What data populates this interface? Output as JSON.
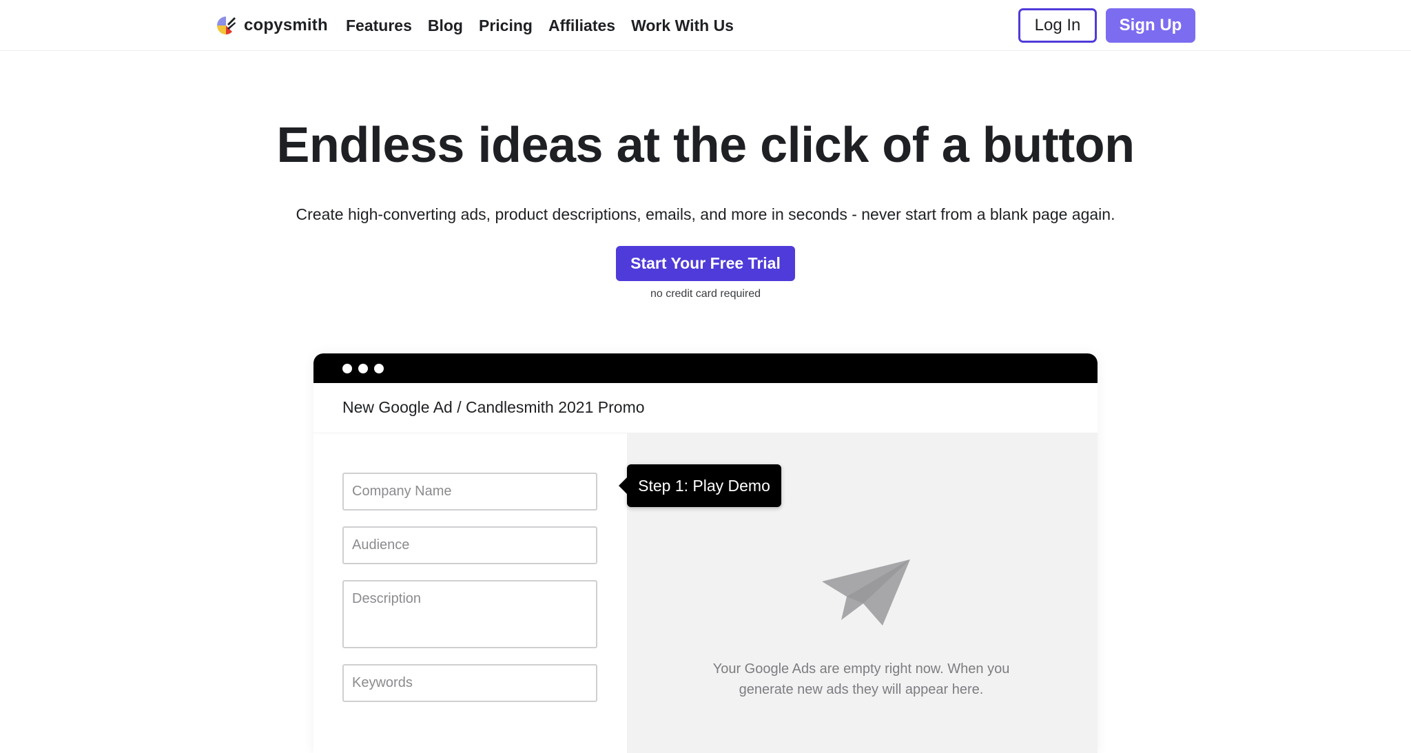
{
  "nav": {
    "logo_text": "copysmith",
    "links": [
      "Features",
      "Blog",
      "Pricing",
      "Affiliates",
      "Work With Us"
    ],
    "login_label": "Log In",
    "signup_label": "Sign Up"
  },
  "hero": {
    "title": "Endless ideas at the click of a button",
    "subtitle": "Create high-converting ads, product descriptions, emails, and more in seconds - never start from a blank page again.",
    "cta_label": "Start Your Free Trial",
    "cta_note": "no credit card required"
  },
  "demo": {
    "window_title": "New Google Ad / Candlesmith 2021 Promo",
    "fields": {
      "company_placeholder": "Company Name",
      "audience_placeholder": "Audience",
      "description_placeholder": "Description",
      "keywords_placeholder": "Keywords"
    },
    "tooltip": "Step 1: Play Demo",
    "empty_message": "Your Google Ads are empty right now. When you generate new ads they will appear here.",
    "icon": "paper-plane-icon"
  },
  "colors": {
    "primary": "#4f3bd9",
    "signup": "#7c6cf0",
    "text": "#1f2024",
    "panel_bg": "#f2f2f2"
  }
}
